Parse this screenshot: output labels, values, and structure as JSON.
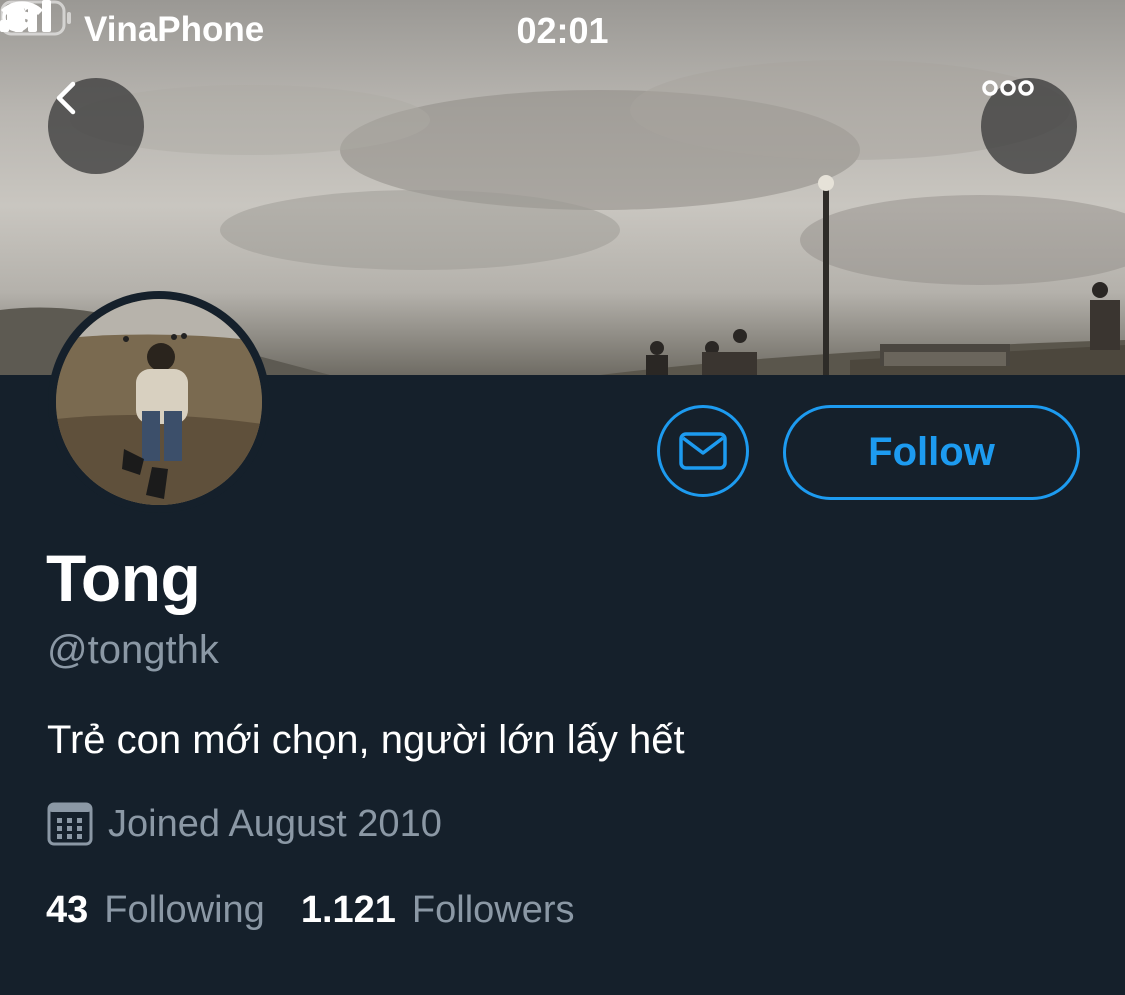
{
  "status_bar": {
    "carrier": "VinaPhone",
    "time": "02:01",
    "battery_level": 0.35
  },
  "header": {
    "back_icon": "chevron-left-icon",
    "more_icon": "more-horizontal-icon"
  },
  "profile": {
    "display_name": "Tong",
    "handle": "@tongthk",
    "bio": "Trẻ con mới chọn, người lớn lấy hết",
    "joined": "Joined August 2010",
    "following_count": "43",
    "following_label": "Following",
    "followers_count": "1.121",
    "followers_label": "Followers"
  },
  "actions": {
    "message_icon": "mail-icon",
    "follow_label": "Follow"
  },
  "colors": {
    "background": "#15202b",
    "accent": "#1d9bf0",
    "secondary_text": "#8b98a5",
    "primary_text": "#ffffff"
  }
}
